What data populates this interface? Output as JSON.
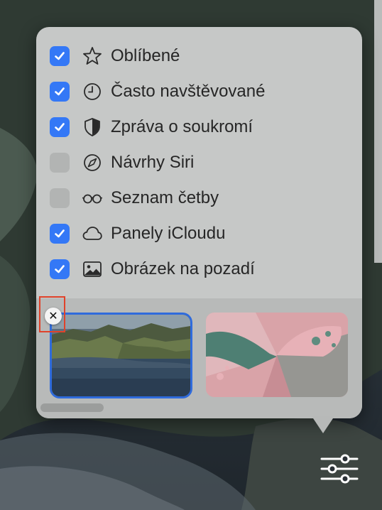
{
  "customize_menu": {
    "items": [
      {
        "label": "Oblíbené",
        "checked": true,
        "icon": "star-icon"
      },
      {
        "label": "Často navštěvované",
        "checked": true,
        "icon": "clock-icon"
      },
      {
        "label": "Zpráva o soukromí",
        "checked": true,
        "icon": "shield-icon"
      },
      {
        "label": "Návrhy Siri",
        "checked": false,
        "icon": "compass-icon"
      },
      {
        "label": "Seznam četby",
        "checked": false,
        "icon": "glasses-icon"
      },
      {
        "label": "Panely iCloudu",
        "checked": true,
        "icon": "cloud-icon"
      },
      {
        "label": "Obrázek na pozadí",
        "checked": true,
        "icon": "image-icon"
      }
    ],
    "backgrounds": {
      "thumbnails": [
        {
          "name": "coastal-landscape",
          "selected": true
        },
        {
          "name": "butterfly-pink",
          "selected": false
        }
      ],
      "remove_symbol": "✕"
    }
  },
  "colors": {
    "accent": "#3478f6",
    "popover": "#c6c8c7",
    "highlight": "#e0422a"
  }
}
